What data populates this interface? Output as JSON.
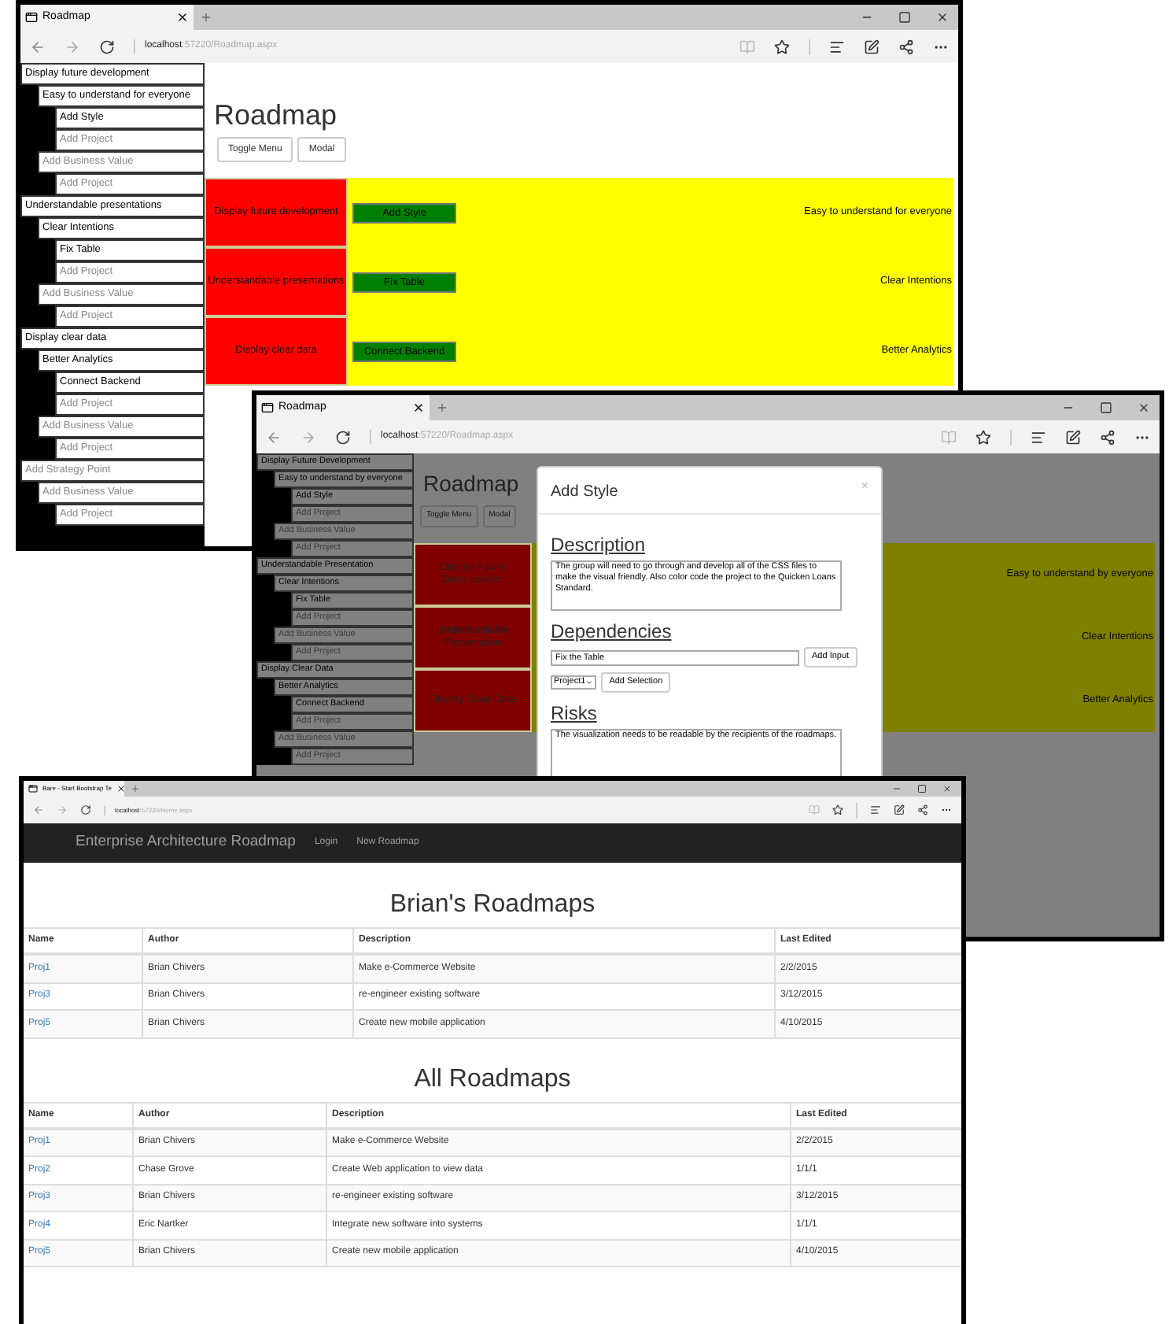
{
  "windows": [
    {
      "kind": "roadmap",
      "dimmed": false,
      "tab": "Roadmap",
      "url": {
        "host": "localhost",
        "path": ":57220/Roadmap.aspx"
      },
      "heading": "Roadmap",
      "buttons": [
        "Toggle Menu",
        "Modal"
      ],
      "sidebar": [
        {
          "label": "Display future development",
          "kind": "item",
          "children": [
            {
              "label": "Easy to understand for everyone",
              "kind": "item",
              "children": [
                {
                  "label": "Add Style",
                  "kind": "item"
                },
                {
                  "label": "Add Project",
                  "kind": "add"
                }
              ]
            },
            {
              "label": "Add Business Value",
              "kind": "add",
              "children": [
                {
                  "label": "Add Project",
                  "kind": "add"
                }
              ]
            }
          ]
        },
        {
          "label": "Understandable presentations",
          "kind": "item",
          "children": [
            {
              "label": "Clear Intentions",
              "kind": "item",
              "children": [
                {
                  "label": "Fix Table",
                  "kind": "item"
                },
                {
                  "label": "Add Project",
                  "kind": "add"
                }
              ]
            },
            {
              "label": "Add Business Value",
              "kind": "add",
              "children": [
                {
                  "label": "Add Project",
                  "kind": "add"
                }
              ]
            }
          ]
        },
        {
          "label": "Display clear data",
          "kind": "item",
          "children": [
            {
              "label": "Better Analytics",
              "kind": "item",
              "children": [
                {
                  "label": "Connect Backend",
                  "kind": "item"
                },
                {
                  "label": "Add Project",
                  "kind": "add"
                }
              ]
            },
            {
              "label": "Add Business Value",
              "kind": "add",
              "children": [
                {
                  "label": "Add Project",
                  "kind": "add"
                }
              ]
            }
          ]
        },
        {
          "label": "Add Strategy Point",
          "kind": "add",
          "children": [
            {
              "label": "Add Business Value",
              "kind": "add",
              "children": [
                {
                  "label": "Add Project",
                  "kind": "add"
                }
              ]
            }
          ]
        }
      ],
      "rows": [
        {
          "goal": "Display future development",
          "project": "Add Style",
          "value": "Easy to understand for everyone"
        },
        {
          "goal": "Understandable presentations",
          "project": "Fix Table",
          "value": "Clear Intentions"
        },
        {
          "goal": "Display clear data",
          "project": "Connect Backend",
          "value": "Better Analytics"
        }
      ]
    },
    {
      "kind": "roadmap",
      "dimmed": true,
      "tab": "Roadmap",
      "url": {
        "host": "localhost",
        "path": ":57220/Roadmap.aspx"
      },
      "heading": "Roadmap",
      "buttons": [
        "Toggle Menu",
        "Modal"
      ],
      "sidebar": [
        {
          "label": "Display Future Development",
          "kind": "item",
          "children": [
            {
              "label": "Easy to understand by everyone",
              "kind": "item",
              "children": [
                {
                  "label": "Add Style",
                  "kind": "item"
                },
                {
                  "label": "Add Project",
                  "kind": "add"
                }
              ]
            },
            {
              "label": "Add Business Value",
              "kind": "add",
              "children": [
                {
                  "label": "Add Project",
                  "kind": "add"
                }
              ]
            }
          ]
        },
        {
          "label": "Understandable Presentation",
          "kind": "item",
          "children": [
            {
              "label": "Clear Intentions",
              "kind": "item",
              "children": [
                {
                  "label": "Fix Table",
                  "kind": "item"
                },
                {
                  "label": "Add Project",
                  "kind": "add"
                }
              ]
            },
            {
              "label": "Add Business Value",
              "kind": "add",
              "children": [
                {
                  "label": "Add Project",
                  "kind": "add"
                }
              ]
            }
          ]
        },
        {
          "label": "Display Clear Data",
          "kind": "item",
          "children": [
            {
              "label": "Better Analytics",
              "kind": "item",
              "children": [
                {
                  "label": "Connect Backend",
                  "kind": "item"
                },
                {
                  "label": "Add Project",
                  "kind": "add"
                }
              ]
            },
            {
              "label": "Add Business Value",
              "kind": "add",
              "children": [
                {
                  "label": "Add Project",
                  "kind": "add"
                }
              ]
            }
          ]
        }
      ],
      "rows": [
        {
          "goal": "Display Future Development",
          "value": "Easy to understand by everyone"
        },
        {
          "goal": "Understandable Presentation",
          "value": "Clear Intentions"
        },
        {
          "goal": "Display Clear Data",
          "value": "Better Analytics"
        }
      ],
      "modal": {
        "title": "Add Style",
        "close": "×",
        "sections": [
          {
            "kind": "textarea",
            "heading": "Description",
            "value": "The group will need to go through and develop all of the CSS files to make the visual friendly. Also color code the project to the Quicken Loans Standard."
          },
          {
            "kind": "dependencies",
            "heading": "Dependencies",
            "input": "Fix the Table",
            "input_button": "Add Input",
            "select": "Project1",
            "select_button": "Add Selection"
          },
          {
            "kind": "textarea",
            "heading": "Risks",
            "value": "The visualization needs to be readable by the recipients of the roadmaps."
          }
        ]
      }
    },
    {
      "kind": "home",
      "tab": "Bare - Start Bootstrap Te",
      "url": {
        "host": "localhost",
        "path": ":57220/Home.aspx"
      },
      "brand": "Enterprise Architecture Roadmap",
      "nav": [
        "Login",
        "New Roadmap"
      ],
      "sections": [
        {
          "title": "Brian's Roadmaps",
          "columns": [
            "Name",
            "Author",
            "Description",
            "Last Edited"
          ],
          "rows": [
            {
              "name": "Proj1",
              "author": "Brian Chivers",
              "description": "Make e-Commerce Website",
              "last_edited": "2/2/2015"
            },
            {
              "name": "Proj3",
              "author": "Brian Chivers",
              "description": "re-engineer existing software",
              "last_edited": "3/12/2015"
            },
            {
              "name": "Proj5",
              "author": "Brian Chivers",
              "description": "Create new mobile application",
              "last_edited": "4/10/2015"
            }
          ]
        },
        {
          "title": "All Roadmaps",
          "columns": [
            "Name",
            "Author",
            "Description",
            "Last Edited"
          ],
          "rows": [
            {
              "name": "Proj1",
              "author": "Brian Chivers",
              "description": "Make e-Commerce Website",
              "last_edited": "2/2/2015"
            },
            {
              "name": "Proj2",
              "author": "Chase Grove",
              "description": "Create Web application to view data",
              "last_edited": "1/1/1"
            },
            {
              "name": "Proj3",
              "author": "Brian Chivers",
              "description": "re-engineer existing software",
              "last_edited": "3/12/2015"
            },
            {
              "name": "Proj4",
              "author": "Eric Nartker",
              "description": "Integrate new software into systems",
              "last_edited": "1/1/1"
            },
            {
              "name": "Proj5",
              "author": "Brian Chivers",
              "description": "Create new mobile application",
              "last_edited": "4/10/2015"
            }
          ]
        }
      ]
    }
  ]
}
